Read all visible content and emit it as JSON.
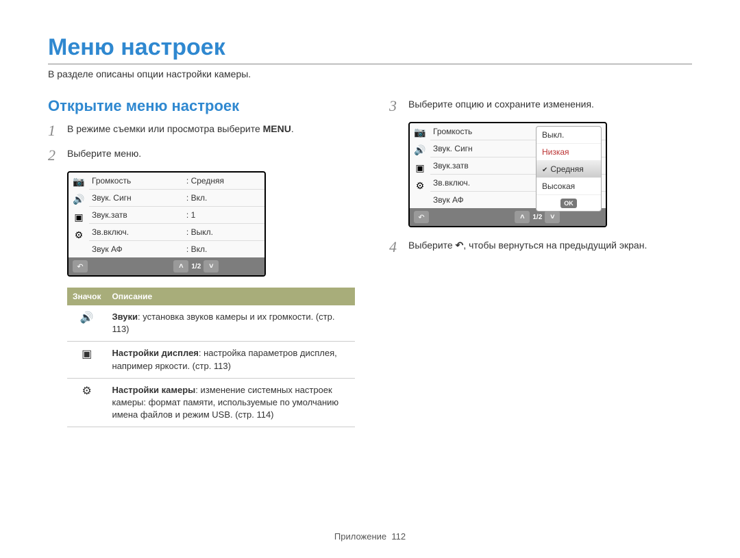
{
  "title": "Меню настроек",
  "subtitle": "В разделе описаны опции настройки камеры.",
  "section_heading": "Открытие меню настроек",
  "steps": {
    "s1_pre": "В режиме съемки или просмотра выберите ",
    "s1_glyph": "MENU",
    "s1_post": ".",
    "s2": "Выберите меню.",
    "s3": "Выберите опцию и сохраните изменения.",
    "s4_pre": "Выберите ",
    "s4_glyph": "↶",
    "s4_post": ", чтобы вернуться на предыдущий экран."
  },
  "step_nums": {
    "n1": "1",
    "n2": "2",
    "n3": "3",
    "n4": "4"
  },
  "menu1": {
    "rows": [
      {
        "label": "Громкость",
        "value": ": Средняя"
      },
      {
        "label": "Звук. Сигн",
        "value": ": Вкл."
      },
      {
        "label": "Звук.затв",
        "value": ": 1"
      },
      {
        "label": "Зв.включ.",
        "value": ": Выкл."
      },
      {
        "label": "Звук АФ",
        "value": ": Вкл."
      }
    ],
    "page": "1/2"
  },
  "menu2": {
    "rows": [
      {
        "label": "Громкость"
      },
      {
        "label": "Звук. Сигн"
      },
      {
        "label": "Звук.затв"
      },
      {
        "label": "Зв.включ."
      },
      {
        "label": "Звук АФ"
      }
    ],
    "popup": {
      "off": "Выкл.",
      "low": "Низкая",
      "mid": "Средняя",
      "high": "Высокая",
      "ok": "OK"
    },
    "page": "1/2"
  },
  "icon_table": {
    "head_icon": "Значок",
    "head_desc": "Описание",
    "r1_bold": "Звуки",
    "r1_rest": ": установка звуков камеры и их громкости. (стр. 113)",
    "r2_bold": "Настройки дисплея",
    "r2_rest": ": настройка параметров дисплея, например яркости. (стр. 113)",
    "r3_bold": "Настройки камеры",
    "r3_rest": ": изменение системных настроек камеры: формат памяти, используемые по умолчанию имена файлов и режим USB. (стр. 114)"
  },
  "footer": {
    "section": "Приложение",
    "page": "112"
  },
  "icons": {
    "camera": "📷",
    "sound": "🔊",
    "display": "▣",
    "gear": "⚙",
    "back": "↶",
    "up": "˄",
    "down": "˅"
  }
}
